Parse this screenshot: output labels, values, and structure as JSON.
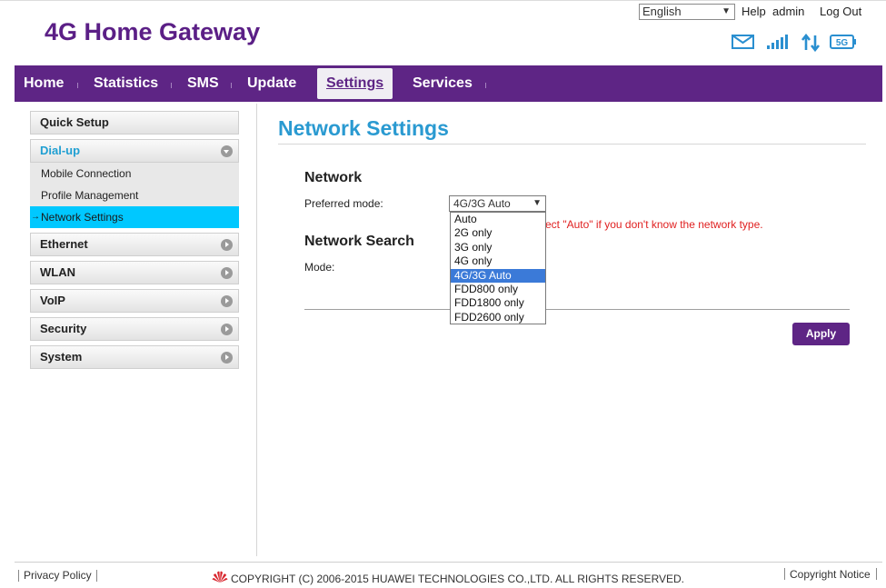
{
  "brand": "4G Home Gateway",
  "language": "English",
  "top_links": {
    "help": "Help",
    "user": "admin",
    "logout": "Log Out"
  },
  "nav": [
    "Home",
    "Statistics",
    "SMS",
    "Update",
    "Settings",
    "Services"
  ],
  "sidebar": {
    "quick_setup": "Quick Setup",
    "dialup": "Dial-up",
    "subitems": [
      "Mobile Connection",
      "Profile Management",
      "Network Settings"
    ],
    "groups": [
      "Ethernet",
      "WLAN",
      "VoIP",
      "Security",
      "System"
    ]
  },
  "page": {
    "title": "Network Settings",
    "network_heading": "Network",
    "preferred_mode_label": "Preferred mode:",
    "preferred_mode_value": "4G/3G Auto",
    "hint": "ect \"Auto\" if you don't know the network type.",
    "search_heading": "Network Search",
    "mode_label": "Mode:",
    "options": [
      "Auto",
      "2G only",
      "3G only",
      "4G only",
      "4G/3G Auto",
      "FDD800 only",
      "FDD1800 only",
      "FDD2600 only"
    ],
    "apply": "Apply"
  },
  "footer": {
    "privacy": "Privacy Policy",
    "copyright": "COPYRIGHT (C) 2006-2015 HUAWEI TECHNOLOGIES CO.,LTD. ALL RIGHTS RESERVED.",
    "notice": "Copyright Notice"
  },
  "colors": {
    "brand_purple": "#5e2585",
    "accent_blue": "#2a9ad1",
    "selected_cyan": "#00c8ff",
    "hint_red": "#e02020"
  },
  "icons": [
    "mail-icon",
    "signal-icon",
    "data-transfer-icon",
    "5g-icon",
    "huawei-logo-icon"
  ]
}
